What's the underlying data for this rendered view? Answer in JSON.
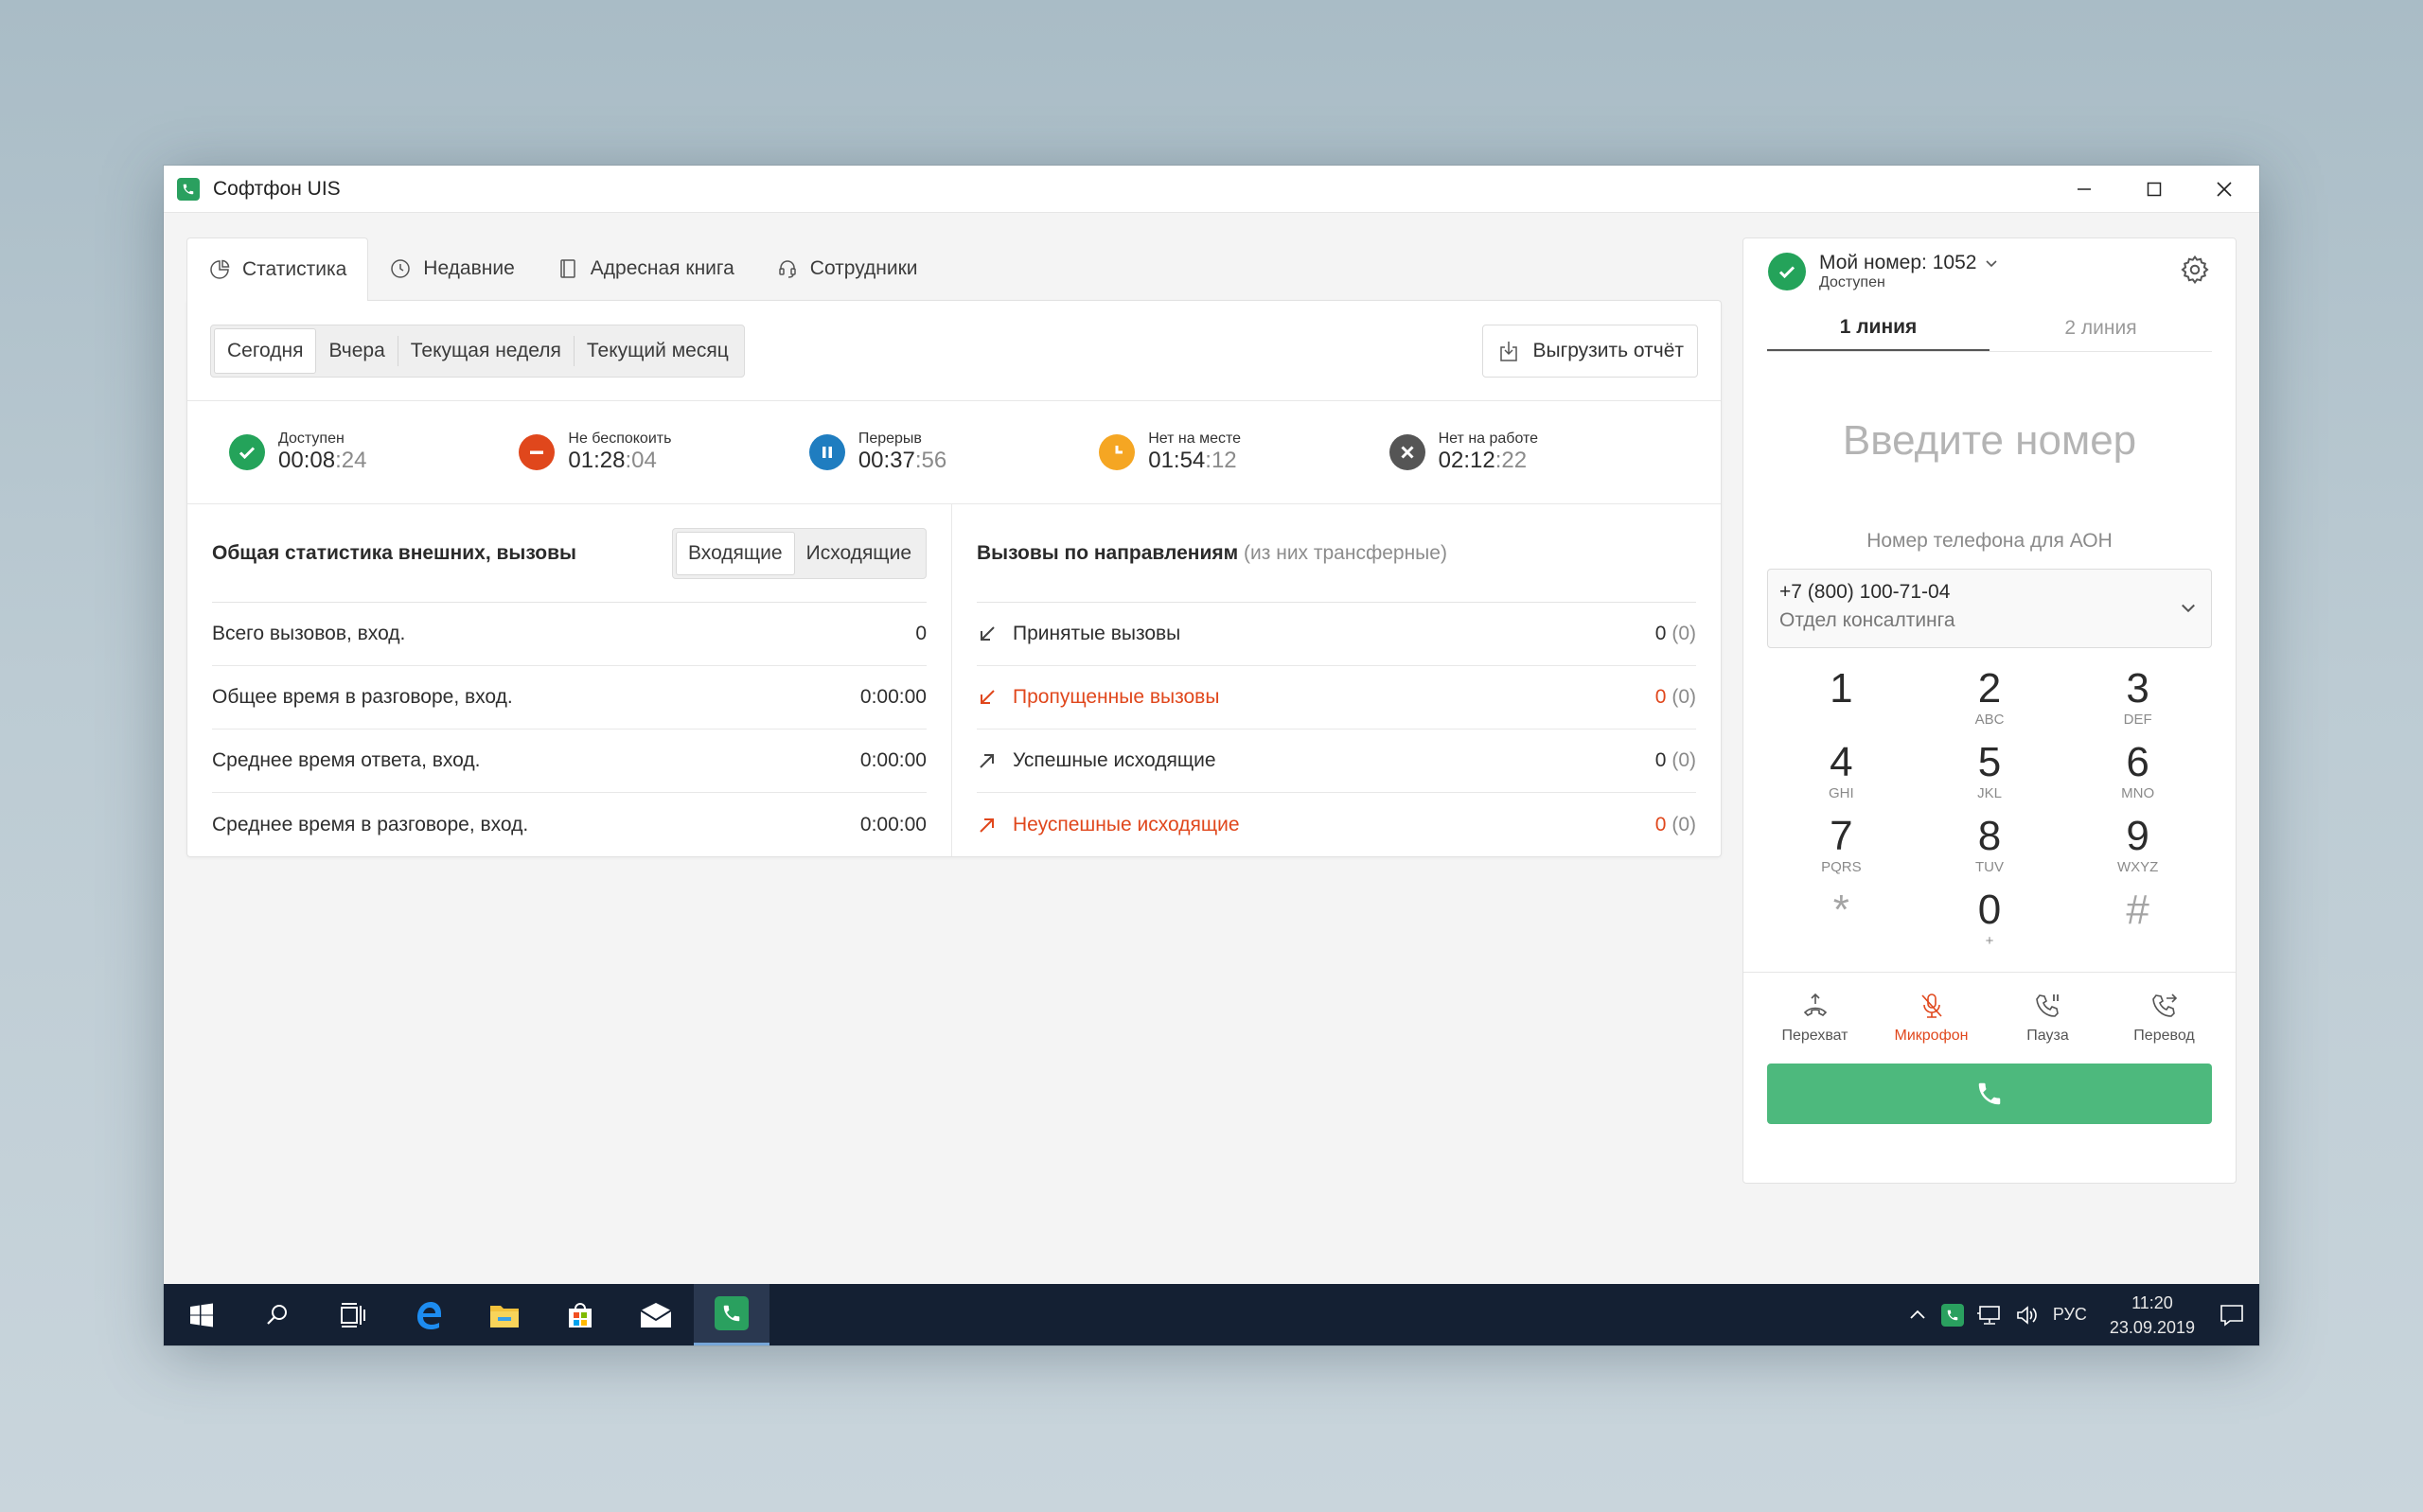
{
  "window": {
    "title": "Софтфон UIS"
  },
  "tabs": [
    {
      "label": "Статистика"
    },
    {
      "label": "Недавние"
    },
    {
      "label": "Адресная книга"
    },
    {
      "label": "Сотрудники"
    }
  ],
  "periods": [
    {
      "label": "Сегодня"
    },
    {
      "label": "Вчера"
    },
    {
      "label": "Текущая неделя"
    },
    {
      "label": "Текущий месяц"
    }
  ],
  "export_label": "Выгрузить отчёт",
  "statuses": [
    {
      "label": "Доступен",
      "hm": "00:08",
      "sec": ":24",
      "color": "#24a35a"
    },
    {
      "label": "Не беспокоить",
      "hm": "01:28",
      "sec": ":04",
      "color": "#e0471c"
    },
    {
      "label": "Перерыв",
      "hm": "00:37",
      "sec": ":56",
      "color": "#1f7dc0"
    },
    {
      "label": "Нет на месте",
      "hm": "01:54",
      "sec": ":12",
      "color": "#f5a623"
    },
    {
      "label": "Нет на работе",
      "hm": "02:12",
      "sec": ":22",
      "color": "#555555"
    }
  ],
  "general": {
    "title": "Общая статистика внешних, вызовы",
    "dir_incoming": "Входящие",
    "dir_outgoing": "Исходящие",
    "rows": [
      {
        "label": "Всего вызовов, вход.",
        "value": "0"
      },
      {
        "label": "Общее время в разговоре, вход.",
        "value": "0:00:00"
      },
      {
        "label": "Среднее время ответа, вход.",
        "value": "0:00:00"
      },
      {
        "label": "Среднее время в разговоре, вход.",
        "value": "0:00:00"
      }
    ]
  },
  "directions": {
    "title": "Вызовы по направлениям",
    "subtitle": "(из них трансферные)",
    "rows": [
      {
        "label": "Принятые вызовы",
        "value": "0",
        "paren": "(0)"
      },
      {
        "label": "Пропущенные вызовы",
        "value": "0",
        "paren": "(0)"
      },
      {
        "label": "Успешные исходящие",
        "value": "0",
        "paren": "(0)"
      },
      {
        "label": "Неуспешные исходящие",
        "value": "0",
        "paren": "(0)"
      }
    ]
  },
  "phone": {
    "my_number": "Мой номер: 1052",
    "status": "Доступен",
    "line1": "1 линия",
    "line2": "2 линия",
    "input_placeholder": "Введите номер",
    "aon_label": "Номер телефона для АОН",
    "aon_number": "+7 (800) 100-71-04",
    "aon_dept": "Отдел консалтинга",
    "keys": [
      {
        "d": "1",
        "s": ""
      },
      {
        "d": "2",
        "s": "ABC"
      },
      {
        "d": "3",
        "s": "DEF"
      },
      {
        "d": "4",
        "s": "GHI"
      },
      {
        "d": "5",
        "s": "JKL"
      },
      {
        "d": "6",
        "s": "MNO"
      },
      {
        "d": "7",
        "s": "PQRS"
      },
      {
        "d": "8",
        "s": "TUV"
      },
      {
        "d": "9",
        "s": "WXYZ"
      },
      {
        "d": "*",
        "s": ""
      },
      {
        "d": "0",
        "s": "+"
      },
      {
        "d": "#",
        "s": ""
      }
    ],
    "actions": [
      {
        "label": "Перехват",
        "icon": "pickup-icon"
      },
      {
        "label": "Микрофон",
        "icon": "microphone-muted-icon"
      },
      {
        "label": "Пауза",
        "icon": "pause-call-icon"
      },
      {
        "label": "Перевод",
        "icon": "transfer-call-icon"
      }
    ]
  },
  "taskbar": {
    "lang": "РУС",
    "time": "11:20",
    "date": "23.09.2019"
  },
  "colors": {
    "accent_green": "#4db97d",
    "red": "#e0471c",
    "taskbar": "#142033"
  }
}
